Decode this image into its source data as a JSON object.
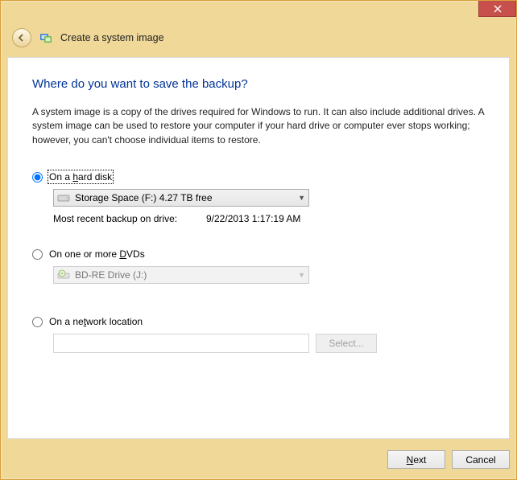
{
  "window": {
    "title": "Create a system image"
  },
  "page": {
    "heading": "Where do you want to save the backup?",
    "description": "A system image is a copy of the drives required for Windows to run. It can also include additional drives. A system image can be used to restore your computer if your hard drive or computer ever stops working; however, you can't choose individual items to restore."
  },
  "options": {
    "hard_disk": {
      "label_pre": "On a ",
      "label_u": "h",
      "label_post": "ard disk",
      "selected": true,
      "drive": "Storage Space (F:)  4.27 TB free",
      "recent_label": "Most recent backup on drive:",
      "recent_value": "9/22/2013 1:17:19 AM"
    },
    "dvd": {
      "label_pre": "On one or more ",
      "label_u": "D",
      "label_post": "VDs",
      "drive": "BD-RE Drive (J:)"
    },
    "network": {
      "label_pre": "On a ne",
      "label_u": "t",
      "label_post": "work location",
      "select_btn": "Select..."
    }
  },
  "footer": {
    "next": "Next",
    "cancel": "Cancel"
  }
}
